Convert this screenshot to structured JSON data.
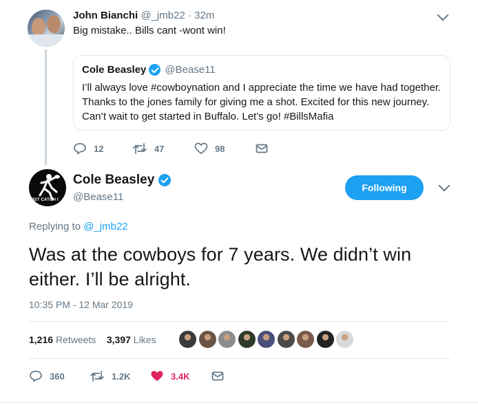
{
  "parent_tweet": {
    "name": "John Bianchi",
    "handle": "@_jmb22",
    "separator": "·",
    "time": "32m",
    "text": "Big mistake.. Bills cant -wont win!",
    "quoted_tweet": {
      "name": "Cole Beasley",
      "handle": "@Bease11",
      "text": "I’ll always love #cowboynation and I appreciate the time we have had together. Thanks to the jones family for giving me a shot. Excited for this new journey. Can’t wait to get started in Buffalo. Let’s go! #BillsMafia"
    },
    "actions": {
      "replies": "12",
      "retweets": "47",
      "likes": "98"
    }
  },
  "main_tweet": {
    "name": "Cole Beasley",
    "handle": "@Bease11",
    "avatar_text": "JST CATCH I",
    "follow_button": "Following",
    "replying_prefix": "Replying to",
    "replying_to": "@_jmb22",
    "text": "Was at the cowboys for 7 years. We didn’t win either. I’ll be alright.",
    "timestamp": "10:35 PM - 12 Mar 2019",
    "retweets_count": "1,216",
    "retweets_label": "Retweets",
    "likes_count": "3,397",
    "likes_label": "Likes",
    "actions": {
      "replies": "360",
      "retweets": "1.2K",
      "likes": "3.4K"
    }
  },
  "colors": {
    "accent": "#1da1f2",
    "muted": "#657786",
    "like": "#e0245e",
    "border": "#e1e8ed"
  },
  "liker_avatars": [
    "#3a3a3a",
    "#6b5443",
    "#8c8c8c",
    "#2e3b2a",
    "#4b4f7a",
    "#4a4a4a",
    "#7a5a48",
    "#232323",
    "#d9d9d9"
  ]
}
